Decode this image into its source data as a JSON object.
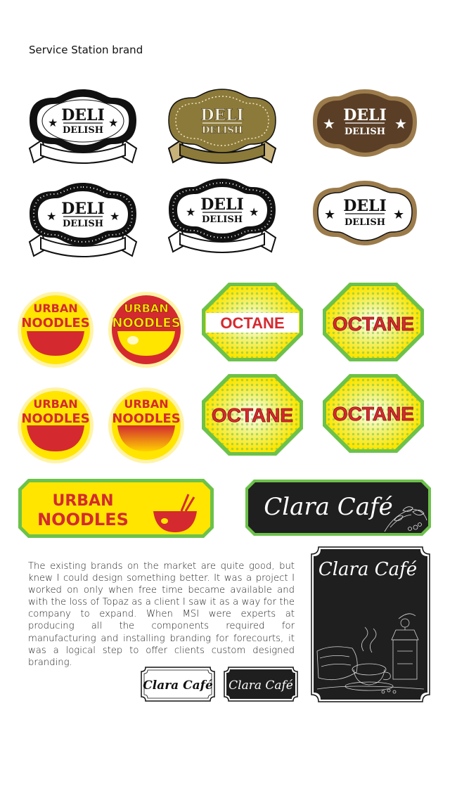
{
  "heading": "Service Station brand",
  "deli": {
    "word1": "DELI",
    "word2": "DELISH"
  },
  "urban": {
    "line1": "URBAN",
    "line2": "NOODLES"
  },
  "octane": {
    "word": "OCTANE"
  },
  "clara": {
    "name": "Clara Café"
  },
  "body_text": "The existing brands on the market are quite good, but knew I could design something better.  It was a project I worked on only when free time became available and with the loss of Topaz as a client I saw it as a way for the company to expand.  When MSI were experts at producing all the components required for manufacturing and installing branding for forecourts, it was a logical step to offer clients custom designed branding.",
  "colors": {
    "gold": "#8c7a3a",
    "brown": "#5a3e26",
    "brown_border": "#9b7b4b",
    "yellow": "#ffe500",
    "red": "#d42a2f",
    "green": "#6cc24a",
    "black": "#1f1f1f"
  }
}
